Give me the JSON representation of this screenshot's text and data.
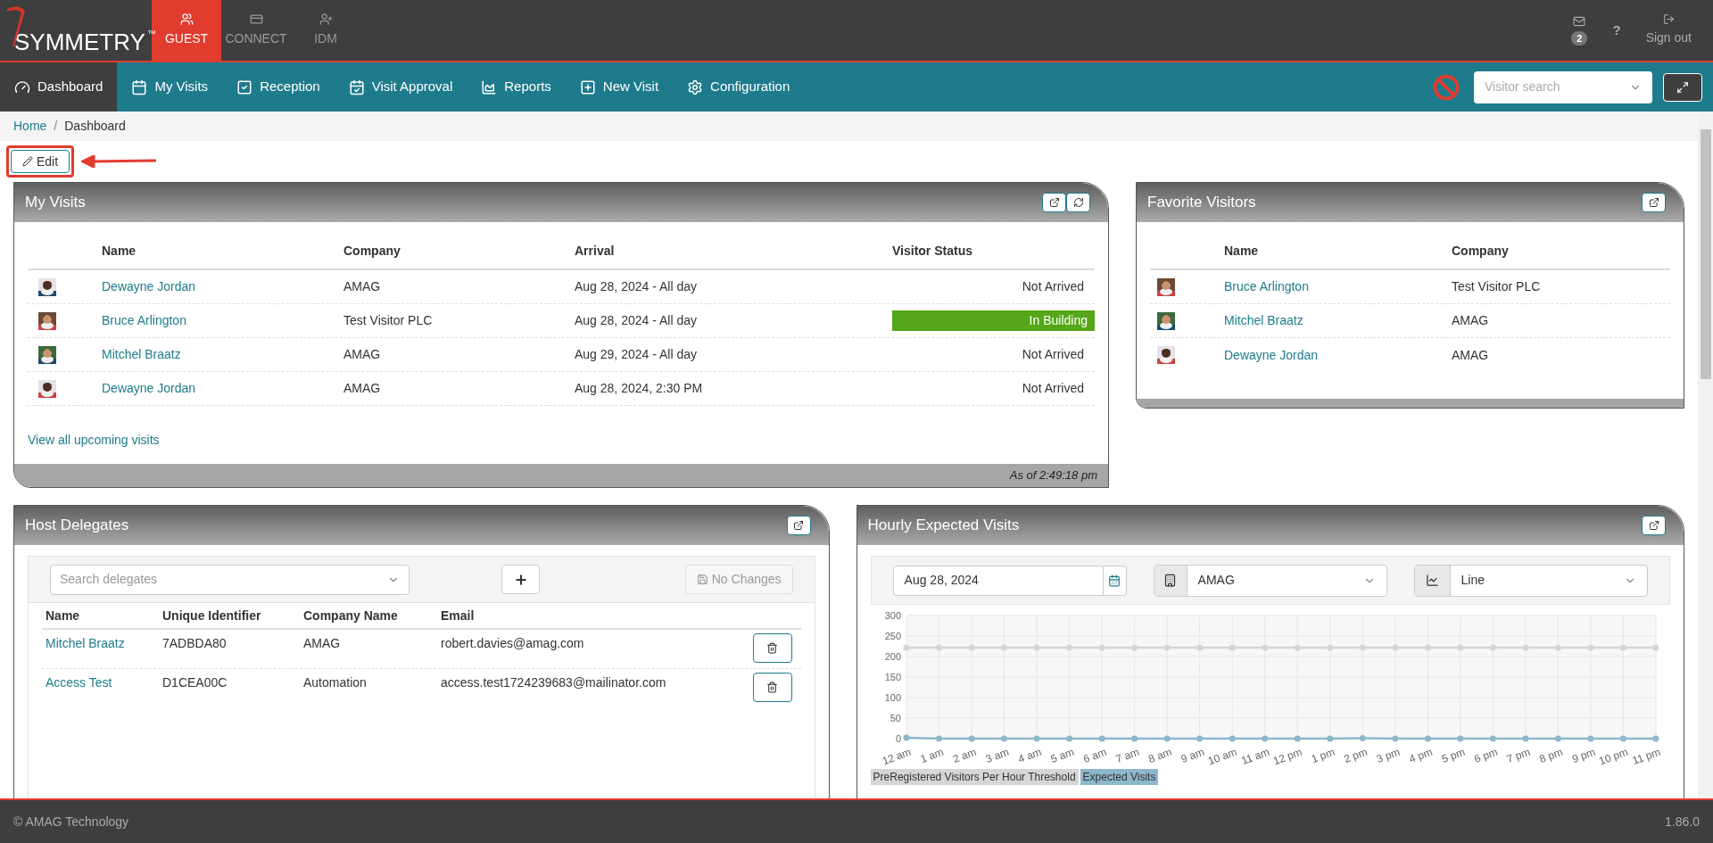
{
  "brand": {
    "name": "SYMMETRY",
    "mark": "™"
  },
  "apps": [
    {
      "label": "GUEST",
      "selected": true
    },
    {
      "label": "CONNECT",
      "selected": false
    },
    {
      "label": "IDM",
      "selected": false
    }
  ],
  "top_right": {
    "mail_count": "2",
    "help": "?",
    "sign_out": "Sign out"
  },
  "nav": [
    {
      "label": "Dashboard",
      "selected": true
    },
    {
      "label": "My Visits",
      "selected": false
    },
    {
      "label": "Reception",
      "selected": false
    },
    {
      "label": "Visit Approval",
      "selected": false
    },
    {
      "label": "Reports",
      "selected": false
    },
    {
      "label": "New Visit",
      "selected": false
    },
    {
      "label": "Configuration",
      "selected": false
    }
  ],
  "visitor_search": {
    "placeholder": "Visitor search"
  },
  "breadcrumb": {
    "separator": "/",
    "items": [
      {
        "label": "Home",
        "link": true
      },
      {
        "label": "Dashboard",
        "link": false
      }
    ]
  },
  "edit_button": "Edit",
  "my_visits": {
    "title": "My Visits",
    "columns": [
      "Name",
      "Company",
      "Arrival",
      "Visitor Status"
    ],
    "rows": [
      {
        "name": "Dewayne Jordan",
        "company": "AMAG",
        "arrival": "Aug 28, 2024 - All day",
        "status": "Not Arrived",
        "active": false
      },
      {
        "name": "Bruce Arlington",
        "company": "Test Visitor PLC",
        "arrival": "Aug 28, 2024 - All day",
        "status": "In Building",
        "active": true
      },
      {
        "name": "Mitchel Braatz",
        "company": "AMAG",
        "arrival": "Aug 29, 2024 - All day",
        "status": "Not Arrived",
        "active": false
      },
      {
        "name": "Dewayne Jordan",
        "company": "AMAG",
        "arrival": "Aug 28, 2024, 2:30 PM",
        "status": "Not Arrived",
        "active": false
      }
    ],
    "link": "View all upcoming visits",
    "footer": "As of 2:49:18 pm"
  },
  "favorites": {
    "title": "Favorite Visitors",
    "columns": [
      "Name",
      "Company"
    ],
    "rows": [
      {
        "name": "Bruce Arlington",
        "company": "Test Visitor PLC"
      },
      {
        "name": "Mitchel Braatz",
        "company": "AMAG"
      },
      {
        "name": "Dewayne Jordan",
        "company": "AMAG"
      }
    ]
  },
  "host_delegates": {
    "title": "Host Delegates",
    "search_placeholder": "Search delegates",
    "save": {
      "label": "No Changes",
      "disabled": true
    },
    "columns": [
      "Name",
      "Unique Identifier",
      "Company Name",
      "Email"
    ],
    "rows": [
      {
        "name": "Mitchel Braatz",
        "id": "7ADBDA80",
        "company": "AMAG",
        "email": "robert.davies@amag.com"
      },
      {
        "name": "Access Test",
        "id": "D1CEA00C",
        "company": "Automation",
        "email": "access.test1724239683@mailinator.com"
      }
    ]
  },
  "hourly": {
    "title": "Hourly Expected Visits",
    "date": "Aug 28, 2024",
    "company": "AMAG",
    "chart_type": "Line",
    "chart_data": {
      "type": "line",
      "categories": [
        "12 am",
        "1 am",
        "2 am",
        "3 am",
        "4 am",
        "5 am",
        "6 am",
        "7 am",
        "8 am",
        "9 am",
        "10 am",
        "11 am",
        "12 pm",
        "1 pm",
        "2 pm",
        "3 pm",
        "4 pm",
        "5 pm",
        "6 pm",
        "7 pm",
        "8 pm",
        "9 pm",
        "10 pm",
        "11 pm"
      ],
      "series": [
        {
          "name": "PreRegistered Visitors Per Hour Threshold",
          "color": "#d6d6d6",
          "marker": true,
          "values": [
            222,
            222,
            222,
            222,
            222,
            222,
            222,
            222,
            222,
            222,
            222,
            222,
            222,
            222,
            222,
            222,
            222,
            222,
            222,
            222,
            222,
            222,
            222,
            222
          ]
        },
        {
          "name": "Expected Visits",
          "color": "#8db7cc",
          "marker": true,
          "values": [
            2,
            0,
            0,
            0,
            0,
            0,
            0,
            0,
            0,
            0,
            0,
            0,
            0,
            0,
            1,
            0,
            0,
            0,
            0,
            0,
            0,
            0,
            0,
            0
          ]
        }
      ],
      "ylim": [
        0,
        300
      ],
      "yticks": [
        0,
        50,
        100,
        150,
        200,
        250,
        300
      ]
    }
  },
  "footer": {
    "copyright": "© AMAG Technology",
    "version": "1.86.0"
  }
}
